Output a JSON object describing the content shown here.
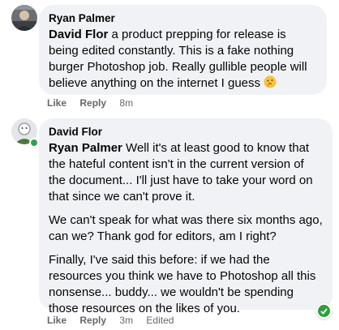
{
  "comments": [
    {
      "author": "Ryan Palmer",
      "mention": "David Flor",
      "text": " a product prepping for release is being edited constantly. This is a fake nothing burger Photoshop job. Really gullible people will believe anything on the internet I guess",
      "emoji": "thinking-face",
      "actions": {
        "like": "Like",
        "reply": "Reply",
        "time": "8m"
      }
    },
    {
      "author": "David Flor",
      "mention": "Ryan Palmer",
      "paragraphs": [
        " Well it's at least good to know that the hateful content isn't in the current version of the document... I'll just have to take your word on that since we can't prove it.",
        "We can't speak for what was there six months ago, can we? Thank god for editors, am I right?",
        "Finally, I've said this before: if we had the resources you think we have to Photoshop all this nonsense... buddy... we wouldn't be spending those resources on the likes of you."
      ],
      "online": true,
      "reaction_icon": "green-reaction-icon",
      "actions": {
        "like": "Like",
        "reply": "Reply",
        "time": "3m",
        "edited": "Edited"
      }
    }
  ],
  "colors": {
    "bubble": "#f0f2f5",
    "text": "#050505",
    "secondary": "#65676b",
    "online": "#31a24c"
  }
}
